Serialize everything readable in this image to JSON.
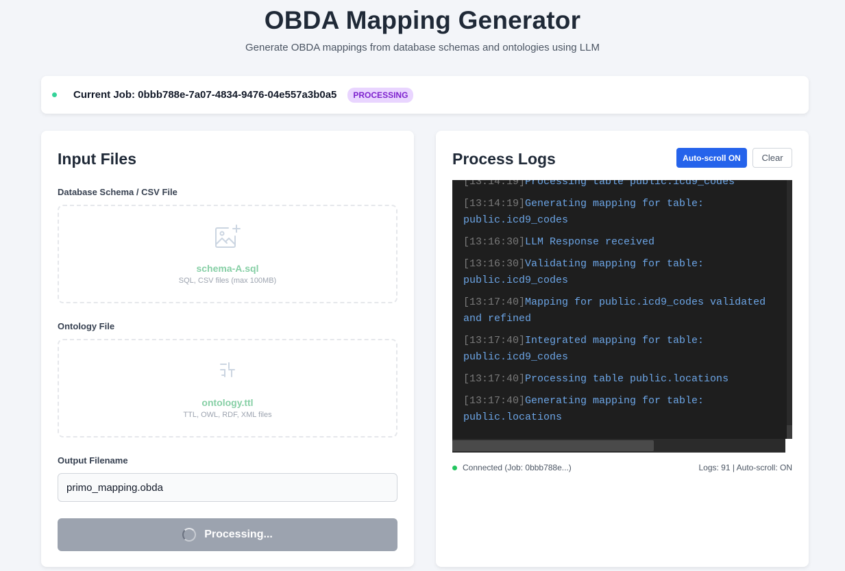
{
  "header": {
    "title": "OBDA Mapping Generator",
    "subtitle": "Generate OBDA mappings from database schemas and ontologies using LLM"
  },
  "job": {
    "label": "Current Job: 0bbb788e-7a07-4834-9476-04e557a3b0a5",
    "status": "PROCESSING"
  },
  "input_panel": {
    "title": "Input Files",
    "schema": {
      "label": "Database Schema / CSV File",
      "filename": "schema-A.sql",
      "hint": "SQL, CSV files (max 100MB)",
      "icon": "image-plus-icon"
    },
    "ontology": {
      "label": "Ontology File",
      "filename": "ontology.ttl",
      "hint": "TTL, OWL, RDF, XML files",
      "icon": "merge-icon"
    },
    "output": {
      "label": "Output Filename",
      "value": "primo_mapping.obda"
    },
    "submit_label": "Processing..."
  },
  "logs_panel": {
    "title": "Process Logs",
    "autoscroll_label": "Auto-scroll ON",
    "clear_label": "Clear",
    "lines": [
      {
        "ts": "[13:14:19]",
        "msg": "Processing table public.icd9_codes"
      },
      {
        "ts": "[13:14:19]",
        "msg": "Generating mapping for table: public.icd9_codes"
      },
      {
        "ts": "[13:16:30]",
        "msg": "LLM Response received"
      },
      {
        "ts": "[13:16:30]",
        "msg": "Validating mapping for table: public.icd9_codes"
      },
      {
        "ts": "[13:17:40]",
        "msg": "Mapping for public.icd9_codes validated and refined"
      },
      {
        "ts": "[13:17:40]",
        "msg": "Integrated mapping for table: public.icd9_codes"
      },
      {
        "ts": "[13:17:40]",
        "msg": "Processing table public.locations"
      },
      {
        "ts": "[13:17:40]",
        "msg": "Generating mapping for table: public.locations"
      }
    ],
    "connection_status": "Connected (Job: 0bbb788e...)",
    "logs_summary": "Logs: 91 | Auto-scroll: ON"
  },
  "colors": {
    "accent": "#2563eb",
    "status_badge_bg": "#e9d5ff",
    "status_badge_text": "#7e22ce",
    "connected": "#22c55e",
    "filename_green": "#86cfa5"
  }
}
